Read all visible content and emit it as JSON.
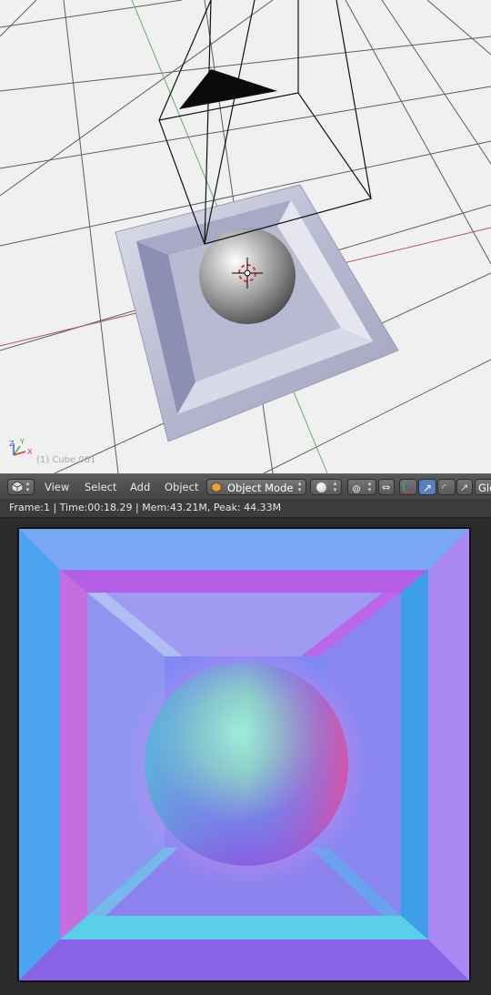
{
  "viewport": {
    "object_label": "(1) Cube.001",
    "axis_labels": {
      "x": "X",
      "y": "Y",
      "z": "Z"
    }
  },
  "header": {
    "menu": {
      "view": "View",
      "select": "Select",
      "add": "Add",
      "object": "Object"
    },
    "mode": "Object Mode",
    "orientation_label": "Glo"
  },
  "status": {
    "text": "Frame:1 | Time:00:18.29 | Mem:43.21M, Peak: 44.33M"
  },
  "colors": {
    "viewport_bg": "#f0f0f0",
    "header_bg": "#4f4f4f",
    "active_blue": "#5680c2",
    "render_border": "#111111"
  }
}
